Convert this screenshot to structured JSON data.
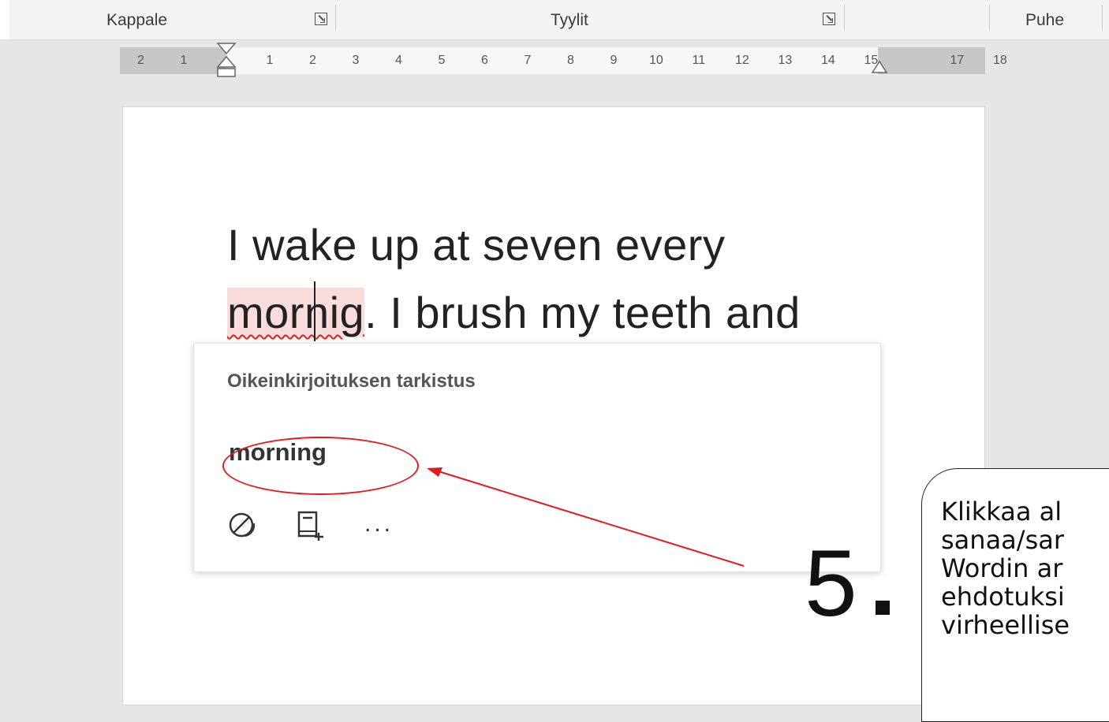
{
  "ribbon": {
    "groups": [
      {
        "label": "Kappale"
      },
      {
        "label": "Tyylit"
      },
      {
        "label": "Puhe"
      }
    ]
  },
  "ruler": {
    "left_numbers": [
      "2",
      "1"
    ],
    "right_numbers": [
      "1",
      "2",
      "3",
      "4",
      "5",
      "6",
      "7",
      "8",
      "9",
      "10",
      "11",
      "12",
      "13",
      "14",
      "15"
    ],
    "far_right_numbers": [
      "17",
      "18"
    ]
  },
  "document": {
    "line1": "I wake up at seven every",
    "line2_misspelled": "mornig",
    "line2_rest": ". I brush my teeth and"
  },
  "spell_popup": {
    "title": "Oikeinkirjoituksen tarkistus",
    "suggestion": "morning",
    "icons": [
      "ignore-icon",
      "add-to-dictionary-icon",
      "more-options-icon"
    ],
    "more_label": "..."
  },
  "annotation": {
    "step_number": "5",
    "callout_lines": [
      "Klikkaa al",
      "sanaa/sar",
      "Wordin ar",
      "ehdotuksi",
      "virheellise"
    ],
    "accent_color": "#e01b1b"
  }
}
